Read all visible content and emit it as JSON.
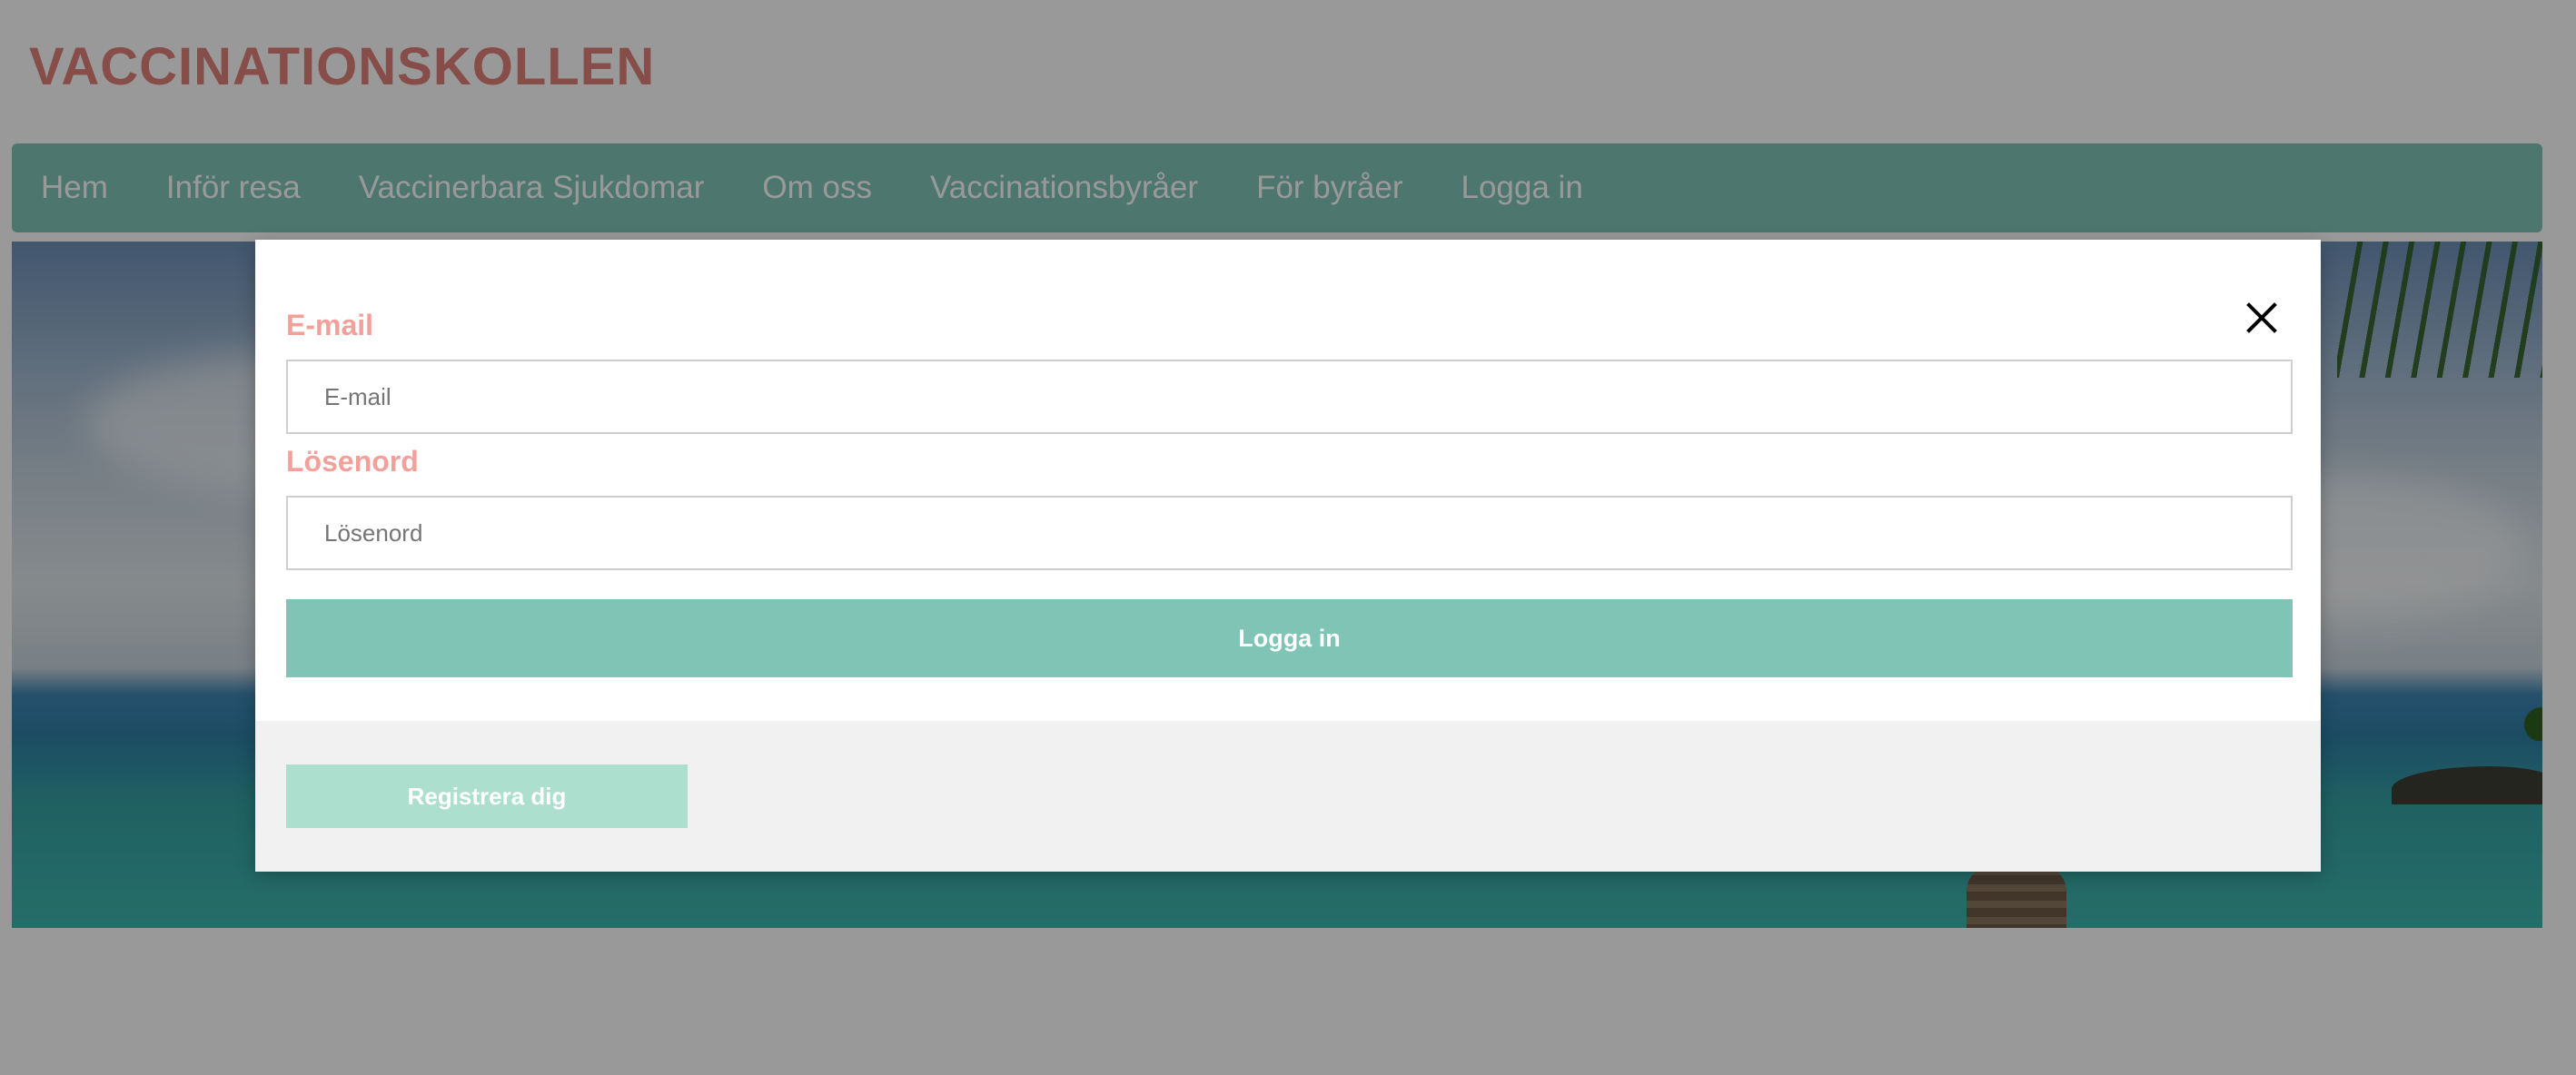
{
  "site": {
    "title": "VACCINATIONSKOLLEN"
  },
  "nav": {
    "items": [
      {
        "label": "Hem"
      },
      {
        "label": "Inför resa"
      },
      {
        "label": "Vaccinerbara Sjukdomar"
      },
      {
        "label": "Om oss"
      },
      {
        "label": "Vaccinationsbyråer"
      },
      {
        "label": "För byråer"
      },
      {
        "label": "Logga in"
      }
    ]
  },
  "login_modal": {
    "close_icon": "close-icon",
    "email_label": "E-mail",
    "email_placeholder": "E-mail",
    "email_value": "",
    "password_label": "Lösenord",
    "password_placeholder": "Lösenord",
    "password_value": "",
    "login_button": "Logga in",
    "register_button": "Registrera dig"
  },
  "colors": {
    "accent": "#80c7b7",
    "title": "#e0807a",
    "label": "#f2a09a",
    "register": "#acdfcd"
  }
}
